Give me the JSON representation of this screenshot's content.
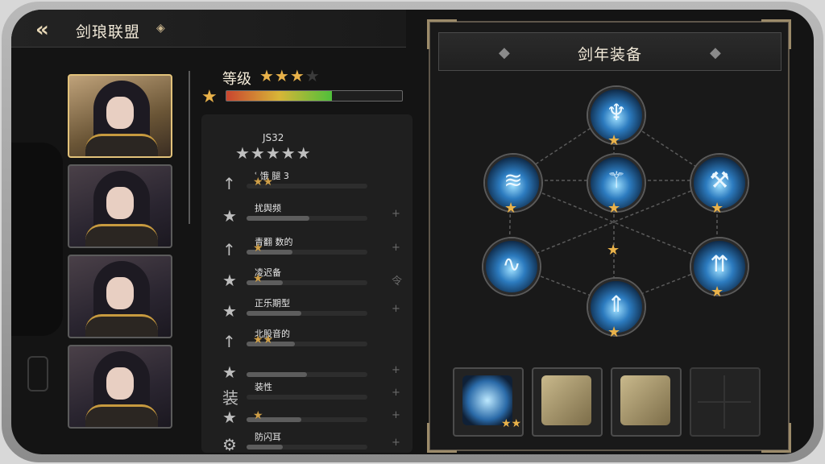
{
  "header": {
    "back_icon": "double-chevron-left-icon",
    "title": "剑琅联盟",
    "title_icon": "diamond-icon"
  },
  "characters": [
    {
      "name": "portrait-1",
      "selected": true
    },
    {
      "name": "portrait-2",
      "selected": false
    },
    {
      "name": "portrait-3",
      "selected": false
    },
    {
      "name": "portrait-4",
      "selected": false
    }
  ],
  "level": {
    "label": "等级",
    "stars": "★★★",
    "dim_star": "★",
    "badge_star": "★",
    "progress_fraction": 0.6
  },
  "summary": {
    "score": "JS32",
    "stars": "★★★★★"
  },
  "stats": [
    {
      "icon": "↑",
      "name": "ՙ 饿 腿 3",
      "stars": "★★",
      "end": "",
      "fill": 0
    },
    {
      "icon": "★",
      "name": "扰舆频",
      "stars": "",
      "end": "+",
      "fill": 0.52
    },
    {
      "icon": "↑",
      "name": "青翻 数的",
      "stars": "★",
      "end": "+",
      "fill": 0.38
    },
    {
      "icon": "★",
      "name": "凌迟备",
      "stars": "★",
      "end": "令",
      "fill": 0.3
    },
    {
      "icon": "★",
      "name": "正乐期型",
      "stars": "",
      "end": "+",
      "fill": 0.45
    },
    {
      "icon": "↑",
      "name": "北股音的",
      "stars": "★★",
      "end": "",
      "fill": 0.4
    },
    {
      "icon": "★",
      "name": "",
      "stars": "",
      "end": "+",
      "fill": 0.5
    },
    {
      "icon": "装",
      "name": "装性",
      "stars": "",
      "end": "+",
      "fill": 0
    },
    {
      "icon": "★",
      "name": "",
      "stars": "★",
      "end": "+",
      "fill": 0.45
    },
    {
      "icon": "⚙",
      "name": "防闪耳",
      "stars": "",
      "end": "+",
      "fill": 0.3
    }
  ],
  "equipment_panel": {
    "title": "剑年装备",
    "left_icon": "diamond-icon",
    "right_icon": "diamond-icon",
    "title_icon": "diamond-icon"
  },
  "skill_nodes": [
    {
      "name": "skill-top",
      "glyph": "♆",
      "star": "★"
    },
    {
      "name": "skill-left-upper",
      "glyph": "≋",
      "star": "★"
    },
    {
      "name": "skill-center",
      "glyph": "⚚",
      "star": "★"
    },
    {
      "name": "skill-right-upper",
      "glyph": "⚒",
      "star": "★"
    },
    {
      "name": "skill-left-lower",
      "glyph": "∿",
      "star": ""
    },
    {
      "name": "skill-right-lower",
      "glyph": "⇈",
      "star": "★"
    },
    {
      "name": "skill-bottom",
      "glyph": "⇑",
      "star": "★"
    }
  ],
  "center_star": "★",
  "slots": [
    {
      "name": "equip-slot-sword",
      "icon": "sword-icon",
      "star": "★★"
    },
    {
      "name": "equip-slot-scaffold-1",
      "icon": "scaffold-icon",
      "star": ""
    },
    {
      "name": "equip-slot-scaffold-2",
      "icon": "scaffold-icon",
      "star": ""
    },
    {
      "name": "equip-slot-empty",
      "icon": "empty-slot-icon",
      "star": ""
    }
  ],
  "colors": {
    "gold": "#e9b24a",
    "accent_blue": "#2c7bbf",
    "frame": "#9c8b6a"
  }
}
